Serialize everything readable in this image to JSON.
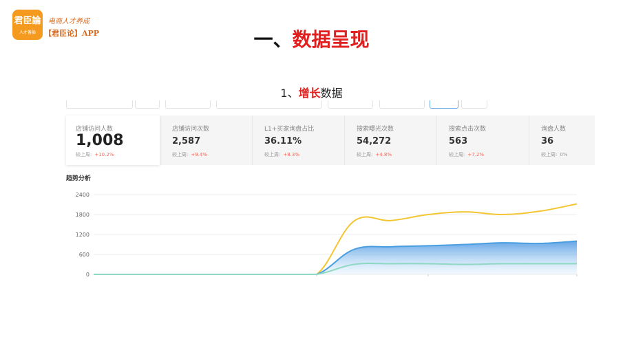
{
  "brand": {
    "logo_text": "君臣論",
    "logo_sub": "人才备胎",
    "slogan": "电商人才养成",
    "app_name": "【君臣论】APP"
  },
  "page": {
    "title_prefix": "一、",
    "title_highlight": "数据呈现",
    "subtitle_prefix": "1、",
    "subtitle_highlight": "增长",
    "subtitle_suffix": "数据"
  },
  "metrics": [
    {
      "label": "店铺访问人数",
      "value": "1,008",
      "compare_label": "较上周:",
      "delta": "+10.2%",
      "active": true
    },
    {
      "label": "店铺访问次数",
      "value": "2,587",
      "compare_label": "较上周:",
      "delta": "+9.4%"
    },
    {
      "label": "L1+买家询盘占比",
      "value": "36.11%",
      "compare_label": "较上周:",
      "delta": "+8.3%"
    },
    {
      "label": "搜索曝光次数",
      "value": "54,272",
      "compare_label": "较上周:",
      "delta": "+4.8%"
    },
    {
      "label": "搜索点击次数",
      "value": "563",
      "compare_label": "较上周:",
      "delta": "+7.2%"
    },
    {
      "label": "询盘人数",
      "value": "36",
      "compare_label": "较上周:",
      "delta": "0%"
    }
  ],
  "trend": {
    "title": "趋势分析"
  },
  "chart_data": {
    "type": "line",
    "yticks": [
      0,
      600,
      1200,
      1800,
      2400
    ],
    "ylim": [
      0,
      2400
    ],
    "x": [
      0,
      1,
      2,
      3,
      4,
      5,
      6,
      7,
      8,
      9,
      10,
      11,
      12,
      13
    ],
    "series": [
      {
        "color": "#f2c531",
        "values": [
          0,
          0,
          0,
          0,
          0,
          0,
          0,
          1600,
          1620,
          1800,
          1880,
          1800,
          1900,
          2120
        ]
      },
      {
        "color": "#4a9ee0",
        "area": true,
        "values": [
          0,
          0,
          0,
          0,
          0,
          0,
          0,
          750,
          830,
          860,
          900,
          950,
          930,
          1000
        ]
      },
      {
        "color": "#8fd8c4",
        "values": [
          0,
          0,
          0,
          0,
          0,
          0,
          0,
          300,
          320,
          320,
          300,
          320,
          320,
          320
        ]
      }
    ]
  }
}
